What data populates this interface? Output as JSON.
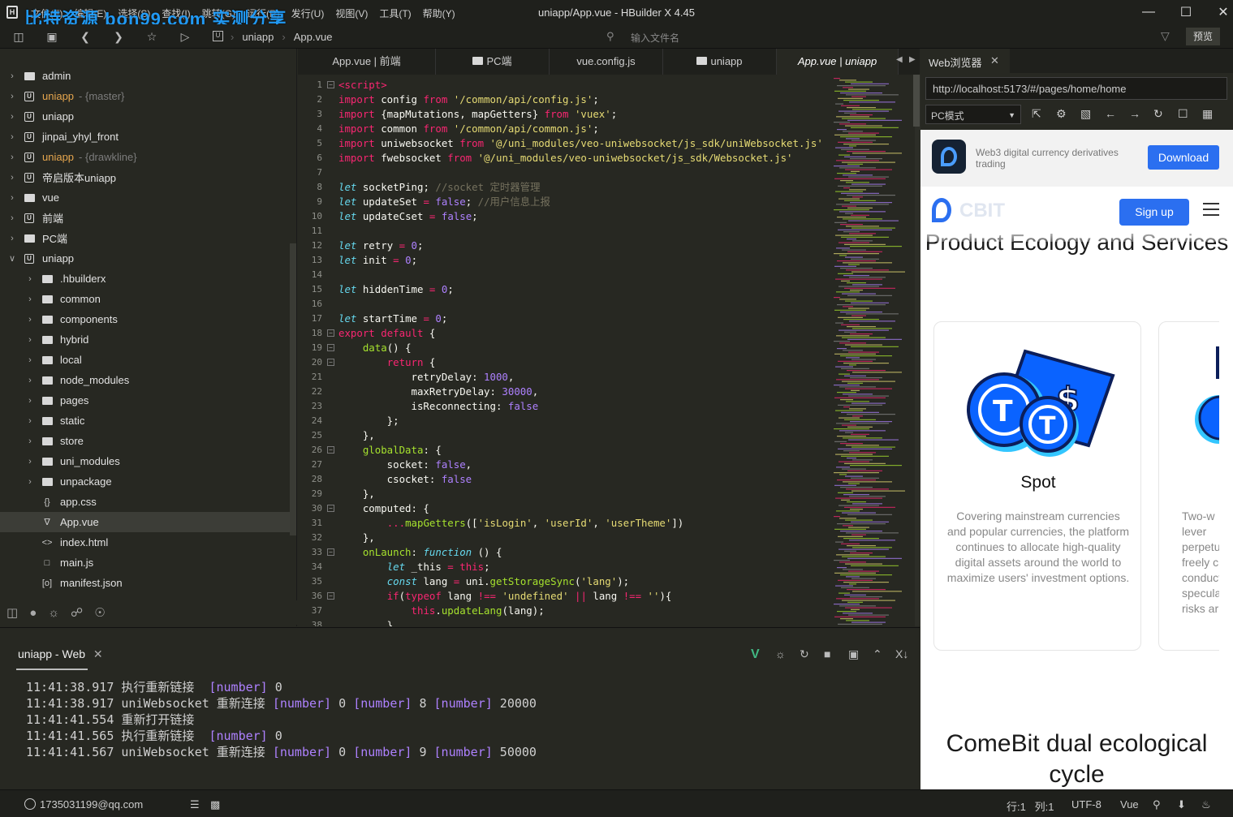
{
  "window": {
    "title": "uniapp/App.vue - HBuilder X 4.45",
    "watermark": "比特资源 bon99.com 实测分享",
    "menu": [
      "文件(F)",
      "编辑(E)",
      "选择(S)",
      "查找(I)",
      "跳转(G)",
      "运行(R)",
      "发行(U)",
      "视图(V)",
      "工具(T)",
      "帮助(Y)"
    ]
  },
  "toolbar": {
    "breadcrumb": [
      "uniapp",
      "App.vue"
    ],
    "file_search_placeholder": "输入文件名",
    "preview_label": "预览"
  },
  "sidebar": {
    "items": [
      {
        "label": "admin",
        "branch": "",
        "type": "folder",
        "depth": 0,
        "expanded": false
      },
      {
        "label": "uniapp",
        "branch": "- {master}",
        "type": "project",
        "depth": 0,
        "expanded": false,
        "highlight": true
      },
      {
        "label": "uniapp",
        "branch": "",
        "type": "project",
        "depth": 0,
        "expanded": false
      },
      {
        "label": "jinpai_yhyl_front",
        "branch": "",
        "type": "project",
        "depth": 0,
        "expanded": false
      },
      {
        "label": "uniapp",
        "branch": "- {drawkline}",
        "type": "project",
        "depth": 0,
        "expanded": false,
        "highlight": true
      },
      {
        "label": "帝启版本uniapp",
        "branch": "",
        "type": "project",
        "depth": 0,
        "expanded": false
      },
      {
        "label": "vue",
        "branch": "",
        "type": "folder",
        "depth": 0,
        "expanded": false
      },
      {
        "label": "前端",
        "branch": "",
        "type": "project",
        "depth": 0,
        "expanded": false
      },
      {
        "label": "PC端",
        "branch": "",
        "type": "folder",
        "depth": 0,
        "expanded": false
      },
      {
        "label": "uniapp",
        "branch": "",
        "type": "project",
        "depth": 0,
        "expanded": true
      },
      {
        "label": ".hbuilderx",
        "branch": "",
        "type": "folder",
        "depth": 1,
        "expanded": false
      },
      {
        "label": "common",
        "branch": "",
        "type": "folder",
        "depth": 1,
        "expanded": false
      },
      {
        "label": "components",
        "branch": "",
        "type": "folder",
        "depth": 1,
        "expanded": false
      },
      {
        "label": "hybrid",
        "branch": "",
        "type": "folder",
        "depth": 1,
        "expanded": false
      },
      {
        "label": "local",
        "branch": "",
        "type": "folder",
        "depth": 1,
        "expanded": false
      },
      {
        "label": "node_modules",
        "branch": "",
        "type": "folder",
        "depth": 1,
        "expanded": false
      },
      {
        "label": "pages",
        "branch": "",
        "type": "folder",
        "depth": 1,
        "expanded": false
      },
      {
        "label": "static",
        "branch": "",
        "type": "folder",
        "depth": 1,
        "expanded": false
      },
      {
        "label": "store",
        "branch": "",
        "type": "folder",
        "depth": 1,
        "expanded": false
      },
      {
        "label": "uni_modules",
        "branch": "",
        "type": "folder",
        "depth": 1,
        "expanded": false
      },
      {
        "label": "unpackage",
        "branch": "",
        "type": "folder",
        "depth": 1,
        "expanded": false
      },
      {
        "label": "app.css",
        "branch": "",
        "type": "css",
        "depth": 1
      },
      {
        "label": "App.vue",
        "branch": "",
        "type": "vue",
        "depth": 1,
        "selected": true
      },
      {
        "label": "index.html",
        "branch": "",
        "type": "html",
        "depth": 1
      },
      {
        "label": "main.js",
        "branch": "",
        "type": "js",
        "depth": 1
      },
      {
        "label": "manifest.json",
        "branch": "",
        "type": "json",
        "depth": 1
      }
    ]
  },
  "tabs": [
    {
      "label": "App.vue | 前端",
      "icon": ""
    },
    {
      "label": "PC端",
      "icon": "folder"
    },
    {
      "label": "vue.config.js",
      "icon": ""
    },
    {
      "label": "uniapp",
      "icon": "folder"
    },
    {
      "label": "App.vue | uniapp",
      "icon": "",
      "active": true
    }
  ],
  "code_lines": [
    [
      [
        "k",
        "<script>"
      ]
    ],
    [
      [
        "k",
        "import"
      ],
      [
        "w",
        " config "
      ],
      [
        "k",
        "from"
      ],
      [
        "w",
        " "
      ],
      [
        "s",
        "'/common/api/config.js'"
      ],
      [
        "w",
        ";"
      ]
    ],
    [
      [
        "k",
        "import"
      ],
      [
        "w",
        " {mapMutations, mapGetters} "
      ],
      [
        "k",
        "from"
      ],
      [
        "w",
        " "
      ],
      [
        "s",
        "'vuex'"
      ],
      [
        "w",
        ";"
      ]
    ],
    [
      [
        "k",
        "import"
      ],
      [
        "w",
        " common "
      ],
      [
        "k",
        "from"
      ],
      [
        "w",
        " "
      ],
      [
        "s",
        "'/common/api/common.js'"
      ],
      [
        "w",
        ";"
      ]
    ],
    [
      [
        "k",
        "import"
      ],
      [
        "w",
        " uniwebsocket "
      ],
      [
        "k",
        "from"
      ],
      [
        "w",
        " "
      ],
      [
        "s",
        "'@/uni_modules/veo-uniwebsocket/js_sdk/uniWebsocket.js'"
      ]
    ],
    [
      [
        "k",
        "import"
      ],
      [
        "w",
        " fwebsocket "
      ],
      [
        "k",
        "from"
      ],
      [
        "w",
        " "
      ],
      [
        "s",
        "'@/uni_modules/veo-uniwebsocket/js_sdk/Websocket.js'"
      ]
    ],
    [],
    [
      [
        "i",
        "let"
      ],
      [
        "w",
        " socketPing; "
      ],
      [
        "c",
        "//socket 定时器管理"
      ]
    ],
    [
      [
        "i",
        "let"
      ],
      [
        "w",
        " updateSet "
      ],
      [
        "k",
        "="
      ],
      [
        "w",
        " "
      ],
      [
        "n",
        "false"
      ],
      [
        "w",
        "; "
      ],
      [
        "c",
        "//用户信息上报"
      ]
    ],
    [
      [
        "i",
        "let"
      ],
      [
        "w",
        " updateCset "
      ],
      [
        "k",
        "="
      ],
      [
        "w",
        " "
      ],
      [
        "n",
        "false"
      ],
      [
        "w",
        ";"
      ]
    ],
    [],
    [
      [
        "i",
        "let"
      ],
      [
        "w",
        " retry "
      ],
      [
        "k",
        "="
      ],
      [
        "w",
        " "
      ],
      [
        "n",
        "0"
      ],
      [
        "w",
        ";"
      ]
    ],
    [
      [
        "i",
        "let"
      ],
      [
        "w",
        " init "
      ],
      [
        "k",
        "="
      ],
      [
        "w",
        " "
      ],
      [
        "n",
        "0"
      ],
      [
        "w",
        ";"
      ]
    ],
    [],
    [
      [
        "i",
        "let"
      ],
      [
        "w",
        " hiddenTime "
      ],
      [
        "k",
        "="
      ],
      [
        "w",
        " "
      ],
      [
        "n",
        "0"
      ],
      [
        "w",
        ";"
      ]
    ],
    [],
    [
      [
        "i",
        "let"
      ],
      [
        "w",
        " startTime "
      ],
      [
        "k",
        "="
      ],
      [
        "w",
        " "
      ],
      [
        "n",
        "0"
      ],
      [
        "w",
        ";"
      ]
    ],
    [
      [
        "k",
        "export"
      ],
      [
        "w",
        " "
      ],
      [
        "k",
        "default"
      ],
      [
        "w",
        " {"
      ]
    ],
    [
      [
        "w",
        "    "
      ],
      [
        "f",
        "data"
      ],
      [
        "w",
        "() {"
      ]
    ],
    [
      [
        "w",
        "        "
      ],
      [
        "k",
        "return"
      ],
      [
        "w",
        " {"
      ]
    ],
    [
      [
        "w",
        "            retryDelay: "
      ],
      [
        "n",
        "1000"
      ],
      [
        "w",
        ","
      ]
    ],
    [
      [
        "w",
        "            maxRetryDelay: "
      ],
      [
        "n",
        "30000"
      ],
      [
        "w",
        ","
      ]
    ],
    [
      [
        "w",
        "            isReconnecting: "
      ],
      [
        "n",
        "false"
      ]
    ],
    [
      [
        "w",
        "        };"
      ]
    ],
    [
      [
        "w",
        "    },"
      ]
    ],
    [
      [
        "w",
        "    "
      ],
      [
        "f",
        "globalData"
      ],
      [
        "w",
        ": {"
      ]
    ],
    [
      [
        "w",
        "        socket: "
      ],
      [
        "n",
        "false"
      ],
      [
        "w",
        ","
      ]
    ],
    [
      [
        "w",
        "        csocket: "
      ],
      [
        "n",
        "false"
      ]
    ],
    [
      [
        "w",
        "    },"
      ]
    ],
    [
      [
        "w",
        "    computed: {"
      ]
    ],
    [
      [
        "w",
        "        "
      ],
      [
        "k",
        "..."
      ],
      [
        "f",
        "mapGetters"
      ],
      [
        "w",
        "(["
      ],
      [
        "s",
        "'isLogin'"
      ],
      [
        "w",
        ", "
      ],
      [
        "s",
        "'userId'"
      ],
      [
        "w",
        ", "
      ],
      [
        "s",
        "'userTheme'"
      ],
      [
        "w",
        "])"
      ]
    ],
    [
      [
        "w",
        "    },"
      ]
    ],
    [
      [
        "w",
        "    "
      ],
      [
        "f",
        "onLaunch"
      ],
      [
        "w",
        ": "
      ],
      [
        "i",
        "function"
      ],
      [
        "w",
        " () {"
      ]
    ],
    [
      [
        "w",
        "        "
      ],
      [
        "i",
        "let"
      ],
      [
        "w",
        " _this "
      ],
      [
        "k",
        "="
      ],
      [
        "w",
        " "
      ],
      [
        "k",
        "this"
      ],
      [
        "w",
        ";"
      ]
    ],
    [
      [
        "w",
        "        "
      ],
      [
        "i",
        "const"
      ],
      [
        "w",
        " lang "
      ],
      [
        "k",
        "="
      ],
      [
        "w",
        " uni."
      ],
      [
        "f",
        "getStorageSync"
      ],
      [
        "w",
        "("
      ],
      [
        "s",
        "'lang'"
      ],
      [
        "w",
        ");"
      ]
    ],
    [
      [
        "w",
        "        "
      ],
      [
        "k",
        "if"
      ],
      [
        "w",
        "("
      ],
      [
        "k",
        "typeof"
      ],
      [
        "w",
        " lang "
      ],
      [
        "k",
        "!=="
      ],
      [
        "w",
        " "
      ],
      [
        "s",
        "'undefined'"
      ],
      [
        "w",
        " "
      ],
      [
        "k",
        "||"
      ],
      [
        "w",
        " lang "
      ],
      [
        "k",
        "!=="
      ],
      [
        "w",
        " "
      ],
      [
        "s",
        "''"
      ],
      [
        "w",
        "){"
      ]
    ],
    [
      [
        "w",
        "            "
      ],
      [
        "k",
        "this"
      ],
      [
        "w",
        "."
      ],
      [
        "f",
        "updateLang"
      ],
      [
        "w",
        "(lang);"
      ]
    ],
    [
      [
        "w",
        "        }"
      ]
    ]
  ],
  "fold_lines": [
    1,
    18,
    19,
    20,
    26,
    30,
    33,
    36
  ],
  "console": {
    "tab_label": "uniapp - Web",
    "lines": [
      [
        [
          "t",
          "11:41:38.917 执行重新链接  "
        ],
        [
          "n",
          "[number]"
        ],
        [
          "t",
          " 0"
        ]
      ],
      [
        [
          "t",
          "11:41:38.917 uniWebsocket 重新连接 "
        ],
        [
          "n",
          "[number]"
        ],
        [
          "t",
          " 0 "
        ],
        [
          "n",
          "[number]"
        ],
        [
          "t",
          " 8 "
        ],
        [
          "n",
          "[number]"
        ],
        [
          "t",
          " 20000"
        ]
      ],
      [
        [
          "t",
          "11:41:41.554 重新打开链接"
        ]
      ],
      [
        [
          "t",
          "11:41:41.565 执行重新链接  "
        ],
        [
          "n",
          "[number]"
        ],
        [
          "t",
          " 0"
        ]
      ],
      [
        [
          "t",
          "11:41:41.567 uniWebsocket 重新连接 "
        ],
        [
          "n",
          "[number]"
        ],
        [
          "t",
          " 0 "
        ],
        [
          "n",
          "[number]"
        ],
        [
          "t",
          " 9 "
        ],
        [
          "n",
          "[number]"
        ],
        [
          "t",
          " 50000"
        ]
      ]
    ]
  },
  "browser": {
    "tab_label": "Web浏览器",
    "url": "http://localhost:5173/#/pages/home/home",
    "mode": "PC模式",
    "banner_text": "Web3 digital currency derivatives trading",
    "download_label": "Download",
    "signup_label": "Sign up",
    "logo_text": "CBIT",
    "section1_title": "Product Ecology and Services",
    "card1": {
      "title": "Spot",
      "desc": "Covering mainstream currencies and popular currencies, the platform continues to allocate high-quality digital assets around the world to maximize users' investment options."
    },
    "card2_desc": "Two-w\nlever\nperpetu\nfreely ch\nconduct\nspeculati\nrisks ar",
    "section2_title": "ComeBit dual ecological cycle"
  },
  "statusbar": {
    "user": "1735031199@qq.com",
    "position": "行:1   列:1",
    "encoding": "UTF-8",
    "language": "Vue"
  },
  "colors": {
    "accent_blue": "#2b6ff0",
    "keyword": "#f92672",
    "string": "#e6db74",
    "number": "#ae81ff",
    "function": "#a6e22e"
  }
}
